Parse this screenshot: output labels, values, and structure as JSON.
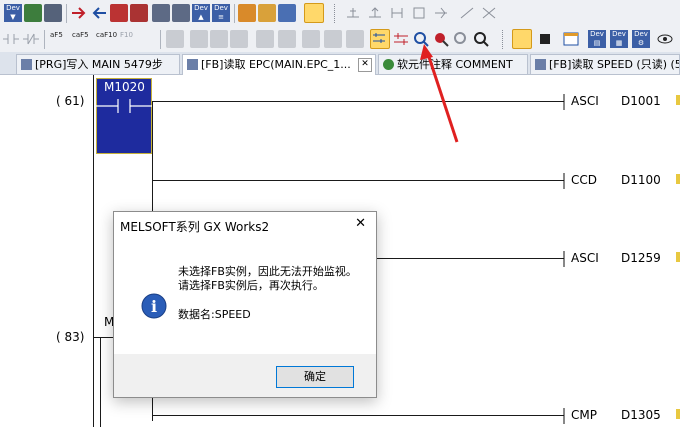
{
  "toolbar2": {
    "items": [
      {
        "label": "aF5"
      },
      {
        "label": "caF5"
      },
      {
        "label": "caF10"
      },
      {
        "label": "F10"
      }
    ]
  },
  "tabs": [
    {
      "label": "[PRG]写入 MAIN 5479步"
    },
    {
      "label": "[FB]读取 EPC(MAIN.EPC_1..."
    },
    {
      "label": "软元件注释 COMMENT"
    },
    {
      "label": "[FB]读取 SPEED (只读) (5"
    }
  ],
  "ladder": {
    "steps": [
      {
        "number": "( 61)"
      },
      {
        "number": "( 83)"
      }
    ],
    "contact_m1020": "M1020",
    "partial_m": "M",
    "instructions": [
      {
        "cmd": "ASCI",
        "operand": "D1001"
      },
      {
        "cmd": "CCD",
        "operand": "D1100"
      },
      {
        "cmd": "ASCI",
        "operand": "D1259"
      },
      {
        "cmd": "CMP",
        "operand": "D1305"
      }
    ]
  },
  "dialog": {
    "title": "MELSOFT系列 GX Works2",
    "close": "✕",
    "line1": "未选择FB实例，因此无法开始监视。",
    "line2": "请选择FB实例后，再次执行。",
    "line3": "数据名:SPEED",
    "ok_label": "确定"
  },
  "annotation_color": "#e02020"
}
